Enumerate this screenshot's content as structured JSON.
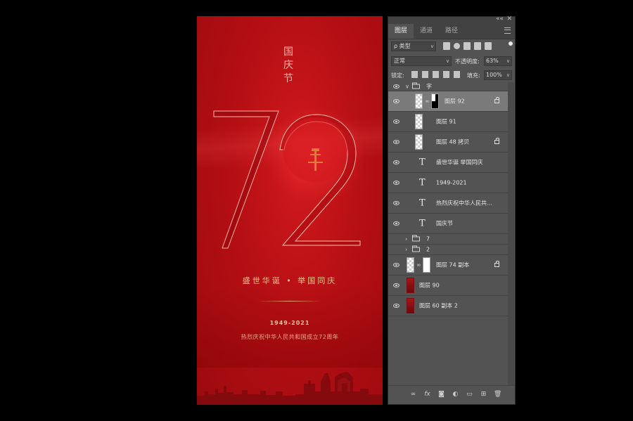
{
  "poster": {
    "vertical_title": "国\n庆\n节",
    "big_number": "72",
    "slogan": "盛世华诞 • 举国同庆",
    "years": "1949-2021",
    "subline": "热烈庆祝中华人民共和国成立72周年",
    "colors": {
      "background": "#b50f14",
      "accent": "#f7c98f"
    }
  },
  "panel": {
    "titlebar": {
      "collapse": "««",
      "close": "✕"
    },
    "tabs": [
      "图层",
      "通道",
      "路径"
    ],
    "active_tab": "图层",
    "filter": {
      "label": "ρ 类型"
    },
    "blend_mode": "正常",
    "opacity_label": "不透明度:",
    "opacity_value": "63%",
    "lock_label": "锁定:",
    "fill_label": "填充:",
    "fill_value": "100%",
    "layers": [
      {
        "name": "字",
        "kind": "group-open"
      },
      {
        "name": "图层 92",
        "kind": "masked",
        "selected": true,
        "locked": true
      },
      {
        "name": "图层 91",
        "kind": "pixel"
      },
      {
        "name": "图层 48 拷贝",
        "kind": "pixel",
        "locked": true
      },
      {
        "name": "盛世华诞 举国同庆",
        "kind": "text"
      },
      {
        "name": "1949-2021",
        "kind": "text"
      },
      {
        "name": "热烈庆祝中华人民共...",
        "kind": "text"
      },
      {
        "name": "国庆节",
        "kind": "text"
      },
      {
        "name": "7",
        "kind": "group-closed"
      },
      {
        "name": "2",
        "kind": "group-closed"
      },
      {
        "name": "图层 74 副本",
        "kind": "masked-white",
        "locked": true
      },
      {
        "name": "图层 90",
        "kind": "red"
      },
      {
        "name": "图层 60 副本 2",
        "kind": "red"
      }
    ],
    "bottom_icons": [
      "link-icon",
      "fx-icon",
      "mask-icon",
      "adjustment-icon",
      "folder-icon",
      "new-layer-icon",
      "trash-icon"
    ]
  }
}
